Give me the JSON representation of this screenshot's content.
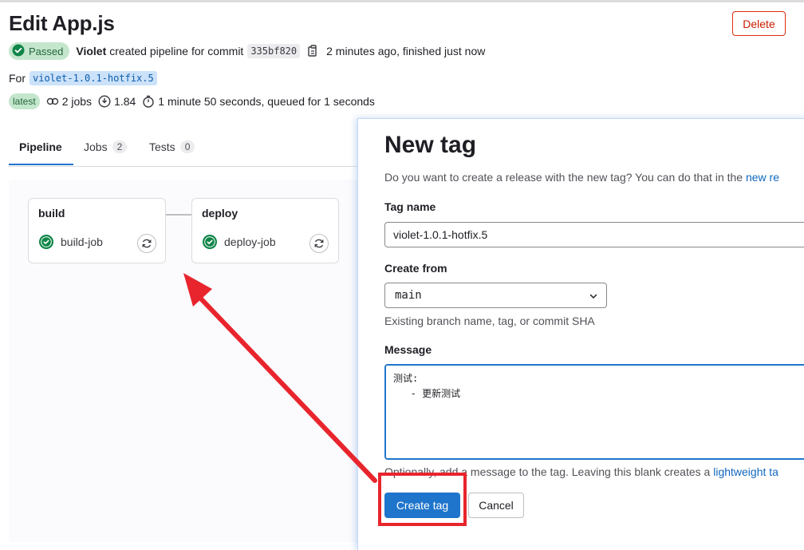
{
  "page": {
    "title": "Edit App.js",
    "delete_label": "Delete"
  },
  "pipeline": {
    "status": "Passed",
    "author": "Violet",
    "created_text": "created pipeline for commit",
    "commit_sha": "335bf820",
    "time_text": "2 minutes ago, finished just now",
    "for_label": "For",
    "branch": "violet-1.0.1-hotfix.5",
    "latest_badge": "latest",
    "jobs_count": "2 jobs",
    "compute": "1.84",
    "duration": "1 minute 50 seconds, queued for 1 seconds"
  },
  "tabs": [
    {
      "label": "Pipeline",
      "count": null
    },
    {
      "label": "Jobs",
      "count": "2"
    },
    {
      "label": "Tests",
      "count": "0"
    }
  ],
  "stages": [
    {
      "name": "build",
      "job": "build-job"
    },
    {
      "name": "deploy",
      "job": "deploy-job"
    }
  ],
  "drawer": {
    "title": "New tag",
    "description": "Do you want to create a release with the new tag? You can do that in the",
    "description_link": "new re",
    "tag_name_label": "Tag name",
    "tag_name_value": "violet-1.0.1-hotfix.5",
    "create_from_label": "Create from",
    "create_from_value": "main",
    "create_from_help": "Existing branch name, tag, or commit SHA",
    "message_label": "Message",
    "message_value": "测试:\n   - 更新测试",
    "message_help": "Optionally, add a message to the tag. Leaving this blank creates a",
    "message_help_link": "lightweight ta",
    "create_button": "Create tag",
    "cancel_button": "Cancel"
  },
  "colors": {
    "primary": "#1f75cb",
    "success": "#108548",
    "danger": "#dd2b0e",
    "annotation": "#e8242c"
  }
}
